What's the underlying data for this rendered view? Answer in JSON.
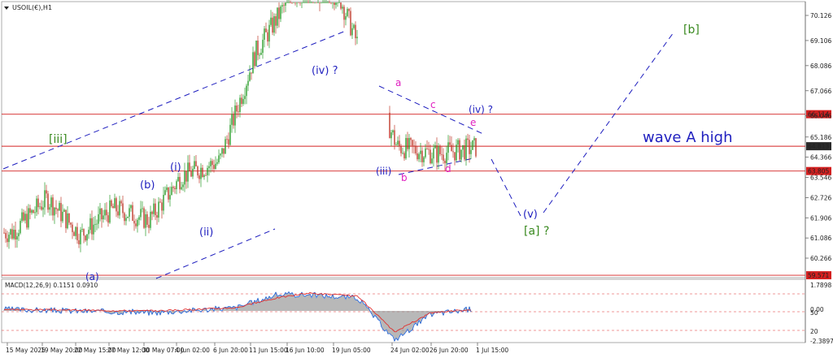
{
  "symbol_label": "USOIL(€),H1",
  "macd_label": "MACD(12,26,9) 0.1151 0.0910",
  "colors": {
    "candle_up": "#2a9d2a",
    "candle_down": "#c0392b",
    "hline": "#d42020",
    "blue_wave": "#1f1fbf",
    "magenta_wave": "#e020c0",
    "green_wave": "#3a8a20",
    "macd_hist": "#9a9a9a",
    "macd_line": "#2a6de0",
    "signal_line": "#e03030",
    "price_box": "#2b2b2b",
    "level_box": "#d42020"
  },
  "chart_data": [
    {
      "type": "line",
      "title": "USOIL(€),H1",
      "timeframe": "H1",
      "candlestick": true,
      "x": [
        "15 May 2025",
        "19 May 20:00",
        "22 May 15:00",
        "27 May 12:00",
        "30 May 07:00",
        "4 Jun 02:00",
        "6 Jun 20:00",
        "11 Jun 15:00",
        "16 Jun 10:00",
        "19 Jun 05:00",
        "24 Jun 02:00",
        "26 Jun 20:00",
        "1 Jul 15:00"
      ],
      "ylim": [
        59.3,
        71.0
      ],
      "yticks": [
        "70.126",
        "69.106",
        "68.086",
        "67.066",
        "66.046",
        "65.186",
        "64.366",
        "63.546",
        "62.726",
        "61.906",
        "61.086",
        "60.266"
      ],
      "series": [
        {
          "values": [
            {
              "x": "15 May 2025",
              "y": 61.3
            },
            {
              "x": "19 May 20:00",
              "y": 62.7
            },
            {
              "x": "22 May 15:00",
              "y": 61.2
            },
            {
              "x": "27 May 12:00",
              "y": 62.3
            },
            {
              "x": "30 May 07:00",
              "y": 61.8
            },
            {
              "x": "4 Jun 02:00",
              "y": 63.6
            },
            {
              "x": "6 Jun 20:00",
              "y": 64.2
            },
            {
              "x": "11 Jun 15:00",
              "y": 68.6
            },
            {
              "x": "16 Jun 10:00",
              "y": 71.0
            },
            {
              "x": "19 Jun 05:00",
              "y": 71.0
            },
            {
              "x": "24 Jun 02:00",
              "y": 64.8
            },
            {
              "x": "26 Jun 20:00",
              "y": 64.5
            },
            {
              "x": "1 Jul 15:00",
              "y": 64.8
            }
          ]
        }
      ],
      "price_levels": [
        {
          "value": "66.114"
        },
        {
          "value": "64.813",
          "current": true
        },
        {
          "value": "63.805"
        },
        {
          "value": "59.571"
        }
      ],
      "annotations": [
        {
          "text": "[iii]",
          "group": "green"
        },
        {
          "text": "(a)",
          "group": "blue"
        },
        {
          "text": "(b)",
          "group": "blue"
        },
        {
          "text": "(i)",
          "group": "blue"
        },
        {
          "text": "(ii)",
          "group": "blue"
        },
        {
          "text": "(iv) ?",
          "group": "blue"
        },
        {
          "text": "(iii)",
          "group": "blue"
        },
        {
          "text": "a",
          "group": "magenta"
        },
        {
          "text": "b",
          "group": "magenta"
        },
        {
          "text": "c",
          "group": "magenta"
        },
        {
          "text": "d",
          "group": "magenta"
        },
        {
          "text": "e",
          "group": "magenta"
        },
        {
          "text": "(iv) ?",
          "group": "blue"
        },
        {
          "text": "(v)",
          "group": "blue"
        },
        {
          "text": "[a] ?",
          "group": "green"
        },
        {
          "text": "[b]",
          "group": "green"
        },
        {
          "text": "wave A high",
          "group": "blue"
        }
      ]
    },
    {
      "type": "bar",
      "title": "MACD(12,26,9) 0.1151 0.0910",
      "ylim": [
        -2.3897,
        1.7898
      ],
      "yticks": [
        "1.7898",
        "0.00",
        "50",
        "20",
        "-2.3897"
      ],
      "series": [
        {
          "name": "MACD",
          "values": [
            {
              "x": "15 May 2025",
              "y": 0.1
            },
            {
              "x": "22 May 15:00",
              "y": 0.0
            },
            {
              "x": "30 May 07:00",
              "y": -0.1
            },
            {
              "x": "6 Jun 20:00",
              "y": 0.2
            },
            {
              "x": "11 Jun 15:00",
              "y": 1.0
            },
            {
              "x": "16 Jun 10:00",
              "y": 1.0
            },
            {
              "x": "19 Jun 05:00",
              "y": 0.8
            },
            {
              "x": "24 Jun 02:00",
              "y": -1.8
            },
            {
              "x": "26 Jun 20:00",
              "y": -0.2
            },
            {
              "x": "1 Jul 15:00",
              "y": 0.1151
            }
          ]
        },
        {
          "name": "Signal",
          "values": [
            {
              "x": "15 May 2025",
              "y": 0.1
            },
            {
              "x": "22 May 15:00",
              "y": 0.05
            },
            {
              "x": "30 May 07:00",
              "y": 0.0
            },
            {
              "x": "6 Jun 20:00",
              "y": 0.2
            },
            {
              "x": "11 Jun 15:00",
              "y": 0.8
            },
            {
              "x": "16 Jun 10:00",
              "y": 1.1
            },
            {
              "x": "19 Jun 05:00",
              "y": 0.9
            },
            {
              "x": "24 Jun 02:00",
              "y": -1.3
            },
            {
              "x": "26 Jun 20:00",
              "y": -0.1
            },
            {
              "x": "1 Jul 15:00",
              "y": 0.091
            }
          ]
        }
      ]
    }
  ]
}
